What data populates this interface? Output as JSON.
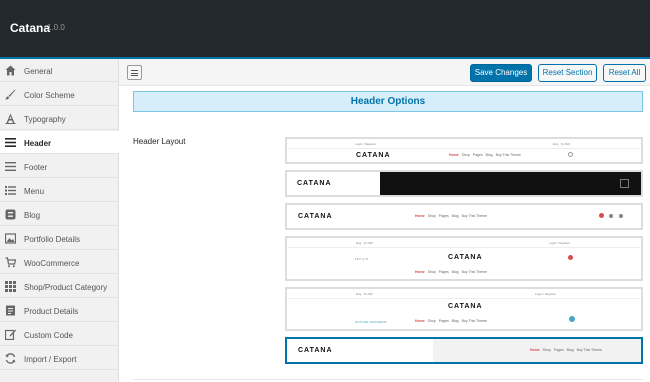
{
  "app": {
    "title": "Catana",
    "version": "1.0.0"
  },
  "sidebar": {
    "items": [
      {
        "label": "General",
        "icon": "home-icon"
      },
      {
        "label": "Color Scheme",
        "icon": "brush-icon"
      },
      {
        "label": "Typography",
        "icon": "typography-icon"
      },
      {
        "label": "Header",
        "icon": "menu-lines-icon"
      },
      {
        "label": "Footer",
        "icon": "menu-lines-icon"
      },
      {
        "label": "Menu",
        "icon": "list-icon"
      },
      {
        "label": "Blog",
        "icon": "blog-icon"
      },
      {
        "label": "Portfolio Details",
        "icon": "image-icon"
      },
      {
        "label": "WooCommerce",
        "icon": "cart-icon"
      },
      {
        "label": "Shop/Product Category",
        "icon": "grid-icon"
      },
      {
        "label": "Product Details",
        "icon": "document-icon"
      },
      {
        "label": "Custom Code",
        "icon": "edit-icon"
      },
      {
        "label": "Import / Export",
        "icon": "refresh-icon"
      }
    ],
    "active_index": 3
  },
  "toolbar": {
    "save_label": "Save Changes",
    "reset_section_label": "Reset Section",
    "reset_all_label": "Reset All"
  },
  "section": {
    "title": "Header Options"
  },
  "field": {
    "label": "Header Layout"
  },
  "layout_previews": {
    "logo_text": "CATANA",
    "nav": [
      "Home",
      "Shop",
      "Pages",
      "Blog",
      "Buy This Theme"
    ],
    "login_text": "Login / Register",
    "currency_text": "Eng · $ USD",
    "hotline_text": "HOTLINE: 0012345678",
    "selected_index": 5
  },
  "colors": {
    "accent": "#0073aa",
    "header_bg": "#23282d",
    "section_bg": "#d6eefa"
  }
}
